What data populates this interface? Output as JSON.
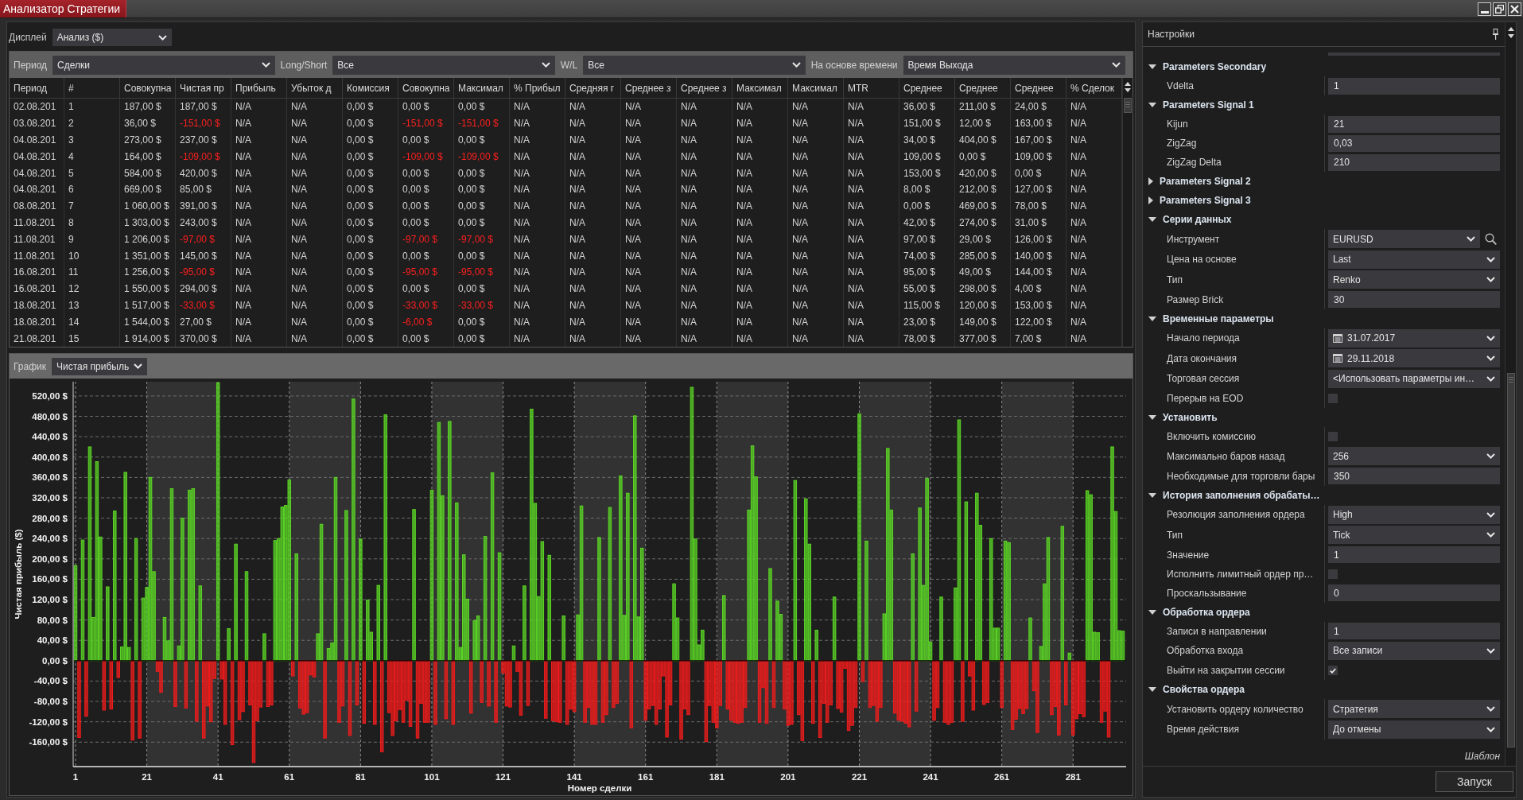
{
  "window": {
    "title": "Анализатор Стратегии"
  },
  "display": {
    "label": "Дисплей",
    "value": "Анализ ($)"
  },
  "filters": [
    {
      "label": "Период",
      "value": "Сделки"
    },
    {
      "label": "Long/Short",
      "value": "Все"
    },
    {
      "label": "W/L",
      "value": "Все"
    },
    {
      "label": "На основе времени",
      "value": "Время Выхода"
    }
  ],
  "table": {
    "columns": [
      "Период",
      "#",
      "Совокупна",
      "Чистая пр",
      "Прибыль",
      "Убыток д",
      "Комиссия",
      "Совокупна",
      "Максимал",
      "% Прибыл",
      "Средняя г",
      "Среднее з",
      "Среднее з",
      "Максимал",
      "Максимал",
      "MTR",
      "Среднее",
      "Среднее",
      "Среднее",
      "% Сделок"
    ],
    "rows": [
      {
        "cells": [
          "02.08.201",
          "1",
          "187,00 $",
          "187,00 $",
          "N/A",
          "N/A",
          "0,00 $",
          "0,00 $",
          "0,00 $",
          "N/A",
          "N/A",
          "N/A",
          "N/A",
          "N/A",
          "N/A",
          "N/A",
          "36,00 $",
          "211,00 $",
          "24,00 $",
          "N/A"
        ],
        "negative": [
          false,
          false,
          false,
          false,
          false,
          false,
          false,
          false,
          false,
          false,
          false,
          false,
          false,
          false,
          false,
          false,
          false,
          false,
          false,
          false
        ]
      },
      {
        "cells": [
          "03.08.201",
          "2",
          "36,00 $",
          "-151,00 $",
          "N/A",
          "N/A",
          "0,00 $",
          "-151,00 $",
          "-151,00 $",
          "N/A",
          "N/A",
          "N/A",
          "N/A",
          "N/A",
          "N/A",
          "N/A",
          "151,00 $",
          "12,00 $",
          "163,00 $",
          "N/A"
        ],
        "negative": [
          false,
          false,
          false,
          true,
          false,
          false,
          false,
          true,
          true,
          false,
          false,
          false,
          false,
          false,
          false,
          false,
          false,
          false,
          false,
          false
        ]
      },
      {
        "cells": [
          "04.08.201",
          "3",
          "273,00 $",
          "237,00 $",
          "N/A",
          "N/A",
          "0,00 $",
          "0,00 $",
          "0,00 $",
          "N/A",
          "N/A",
          "N/A",
          "N/A",
          "N/A",
          "N/A",
          "N/A",
          "34,00 $",
          "404,00 $",
          "167,00 $",
          "N/A"
        ],
        "negative": [
          false,
          false,
          false,
          false,
          false,
          false,
          false,
          false,
          false,
          false,
          false,
          false,
          false,
          false,
          false,
          false,
          false,
          false,
          false,
          false
        ]
      },
      {
        "cells": [
          "04.08.201",
          "4",
          "164,00 $",
          "-109,00 $",
          "N/A",
          "N/A",
          "0,00 $",
          "-109,00 $",
          "-109,00 $",
          "N/A",
          "N/A",
          "N/A",
          "N/A",
          "N/A",
          "N/A",
          "N/A",
          "109,00 $",
          "0,00 $",
          "109,00 $",
          "N/A"
        ],
        "negative": [
          false,
          false,
          false,
          true,
          false,
          false,
          false,
          true,
          true,
          false,
          false,
          false,
          false,
          false,
          false,
          false,
          false,
          false,
          false,
          false
        ]
      },
      {
        "cells": [
          "04.08.201",
          "5",
          "584,00 $",
          "420,00 $",
          "N/A",
          "N/A",
          "0,00 $",
          "0,00 $",
          "0,00 $",
          "N/A",
          "N/A",
          "N/A",
          "N/A",
          "N/A",
          "N/A",
          "N/A",
          "153,00 $",
          "420,00 $",
          "0,00 $",
          "N/A"
        ],
        "negative": [
          false,
          false,
          false,
          false,
          false,
          false,
          false,
          false,
          false,
          false,
          false,
          false,
          false,
          false,
          false,
          false,
          false,
          false,
          false,
          false
        ]
      },
      {
        "cells": [
          "04.08.201",
          "6",
          "669,00 $",
          "85,00 $",
          "N/A",
          "N/A",
          "0,00 $",
          "0,00 $",
          "0,00 $",
          "N/A",
          "N/A",
          "N/A",
          "N/A",
          "N/A",
          "N/A",
          "N/A",
          "8,00 $",
          "212,00 $",
          "127,00 $",
          "N/A"
        ],
        "negative": [
          false,
          false,
          false,
          false,
          false,
          false,
          false,
          false,
          false,
          false,
          false,
          false,
          false,
          false,
          false,
          false,
          false,
          false,
          false,
          false
        ]
      },
      {
        "cells": [
          "08.08.201",
          "7",
          "1 060,00 $",
          "391,00 $",
          "N/A",
          "N/A",
          "0,00 $",
          "0,00 $",
          "0,00 $",
          "N/A",
          "N/A",
          "N/A",
          "N/A",
          "N/A",
          "N/A",
          "N/A",
          "0,00 $",
          "469,00 $",
          "78,00 $",
          "N/A"
        ],
        "negative": [
          false,
          false,
          false,
          false,
          false,
          false,
          false,
          false,
          false,
          false,
          false,
          false,
          false,
          false,
          false,
          false,
          false,
          false,
          false,
          false
        ]
      },
      {
        "cells": [
          "11.08.201",
          "8",
          "1 303,00 $",
          "243,00 $",
          "N/A",
          "N/A",
          "0,00 $",
          "0,00 $",
          "0,00 $",
          "N/A",
          "N/A",
          "N/A",
          "N/A",
          "N/A",
          "N/A",
          "N/A",
          "42,00 $",
          "274,00 $",
          "31,00 $",
          "N/A"
        ],
        "negative": [
          false,
          false,
          false,
          false,
          false,
          false,
          false,
          false,
          false,
          false,
          false,
          false,
          false,
          false,
          false,
          false,
          false,
          false,
          false,
          false
        ]
      },
      {
        "cells": [
          "11.08.201",
          "9",
          "1 206,00 $",
          "-97,00 $",
          "N/A",
          "N/A",
          "0,00 $",
          "-97,00 $",
          "-97,00 $",
          "N/A",
          "N/A",
          "N/A",
          "N/A",
          "N/A",
          "N/A",
          "N/A",
          "97,00 $",
          "29,00 $",
          "126,00 $",
          "N/A"
        ],
        "negative": [
          false,
          false,
          false,
          true,
          false,
          false,
          false,
          true,
          true,
          false,
          false,
          false,
          false,
          false,
          false,
          false,
          false,
          false,
          false,
          false
        ]
      },
      {
        "cells": [
          "11.08.201",
          "10",
          "1 351,00 $",
          "145,00 $",
          "N/A",
          "N/A",
          "0,00 $",
          "0,00 $",
          "0,00 $",
          "N/A",
          "N/A",
          "N/A",
          "N/A",
          "N/A",
          "N/A",
          "N/A",
          "74,00 $",
          "285,00 $",
          "140,00 $",
          "N/A"
        ],
        "negative": [
          false,
          false,
          false,
          false,
          false,
          false,
          false,
          false,
          false,
          false,
          false,
          false,
          false,
          false,
          false,
          false,
          false,
          false,
          false,
          false
        ]
      },
      {
        "cells": [
          "16.08.201",
          "11",
          "1 256,00 $",
          "-95,00 $",
          "N/A",
          "N/A",
          "0,00 $",
          "-95,00 $",
          "-95,00 $",
          "N/A",
          "N/A",
          "N/A",
          "N/A",
          "N/A",
          "N/A",
          "N/A",
          "95,00 $",
          "49,00 $",
          "144,00 $",
          "N/A"
        ],
        "negative": [
          false,
          false,
          false,
          true,
          false,
          false,
          false,
          true,
          true,
          false,
          false,
          false,
          false,
          false,
          false,
          false,
          false,
          false,
          false,
          false
        ]
      },
      {
        "cells": [
          "16.08.201",
          "12",
          "1 550,00 $",
          "294,00 $",
          "N/A",
          "N/A",
          "0,00 $",
          "0,00 $",
          "0,00 $",
          "N/A",
          "N/A",
          "N/A",
          "N/A",
          "N/A",
          "N/A",
          "N/A",
          "55,00 $",
          "298,00 $",
          "4,00 $",
          "N/A"
        ],
        "negative": [
          false,
          false,
          false,
          false,
          false,
          false,
          false,
          false,
          false,
          false,
          false,
          false,
          false,
          false,
          false,
          false,
          false,
          false,
          false,
          false
        ]
      },
      {
        "cells": [
          "18.08.201",
          "13",
          "1 517,00 $",
          "-33,00 $",
          "N/A",
          "N/A",
          "0,00 $",
          "-33,00 $",
          "-33,00 $",
          "N/A",
          "N/A",
          "N/A",
          "N/A",
          "N/A",
          "N/A",
          "N/A",
          "115,00 $",
          "120,00 $",
          "153,00 $",
          "N/A"
        ],
        "negative": [
          false,
          false,
          false,
          true,
          false,
          false,
          false,
          true,
          true,
          false,
          false,
          false,
          false,
          false,
          false,
          false,
          false,
          false,
          false,
          false
        ]
      },
      {
        "cells": [
          "18.08.201",
          "14",
          "1 544,00 $",
          "27,00 $",
          "N/A",
          "N/A",
          "0,00 $",
          "-6,00 $",
          "0,00 $",
          "N/A",
          "N/A",
          "N/A",
          "N/A",
          "N/A",
          "N/A",
          "N/A",
          "23,00 $",
          "149,00 $",
          "122,00 $",
          "N/A"
        ],
        "negative": [
          false,
          false,
          false,
          false,
          false,
          false,
          false,
          true,
          false,
          false,
          false,
          false,
          false,
          false,
          false,
          false,
          false,
          false,
          false,
          false
        ]
      },
      {
        "cells": [
          "21.08.201",
          "15",
          "1 914,00 $",
          "370,00 $",
          "N/A",
          "N/A",
          "0,00 $",
          "0,00 $",
          "0,00 $",
          "N/A",
          "N/A",
          "N/A",
          "N/A",
          "N/A",
          "N/A",
          "N/A",
          "78,00 $",
          "377,00 $",
          "7,00 $",
          "N/A"
        ],
        "negative": [
          false,
          false,
          false,
          false,
          false,
          false,
          false,
          false,
          false,
          false,
          false,
          false,
          false,
          false,
          false,
          false,
          false,
          false,
          false,
          false
        ]
      }
    ]
  },
  "graph": {
    "label": "График",
    "value": "Чистая прибыль",
    "chart_data": [
      {
        "type": "bar",
        "xlabel": "Номер сделки",
        "ylabel": "Чистая прибыль ($)",
        "grid": true,
        "xlim": [
          0.33,
          295.9
        ],
        "ylim": [
          -208,
          548
        ],
        "xticks": [
          1,
          21,
          41,
          61,
          81,
          101,
          121,
          141,
          161,
          181,
          201,
          221,
          241,
          261,
          281
        ],
        "yticks": [
          {
            "value": -160,
            "label": "-160,00 $"
          },
          {
            "value": -120,
            "label": "-120,00 $"
          },
          {
            "value": -80,
            "label": "-80,00 $"
          },
          {
            "value": -40,
            "label": "-40,00 $"
          },
          {
            "value": 0,
            "label": "0,00 $"
          },
          {
            "value": 40,
            "label": "40,00 $"
          },
          {
            "value": 80,
            "label": "80,00 $"
          },
          {
            "value": 120,
            "label": "120,00 $"
          },
          {
            "value": 160,
            "label": "160,00 $"
          },
          {
            "value": 200,
            "label": "200,00 $"
          },
          {
            "value": 240,
            "label": "240,00 $"
          },
          {
            "value": 280,
            "label": "280,00 $"
          },
          {
            "value": 320,
            "label": "320,00 $"
          },
          {
            "value": 360,
            "label": "360,00 $"
          },
          {
            "value": 400,
            "label": "400,00 $"
          },
          {
            "value": 440,
            "label": "440,00 $"
          },
          {
            "value": 480,
            "label": "480,00 $"
          },
          {
            "value": 520,
            "label": "520,00 $"
          }
        ],
        "x": [
          1,
          2,
          3,
          4,
          5,
          6,
          7,
          8,
          9,
          10,
          11,
          12,
          13,
          14,
          15,
          16,
          17,
          18,
          19,
          20,
          21,
          22,
          23,
          24,
          25,
          26,
          27,
          28,
          29,
          30,
          31,
          32,
          33,
          34,
          35,
          36,
          37,
          38,
          39,
          40,
          41,
          42,
          43,
          44,
          45,
          46,
          47,
          48,
          49,
          50,
          51,
          52,
          53,
          54,
          55,
          56,
          57,
          58,
          59,
          60,
          61,
          62,
          63,
          64,
          65,
          66,
          67,
          68,
          69,
          70,
          71,
          72,
          73,
          74,
          75,
          76,
          77,
          78,
          79,
          80,
          81,
          82,
          83,
          84,
          85,
          86,
          87,
          88,
          89,
          90,
          91,
          92,
          93,
          94,
          95,
          96,
          97,
          98,
          99,
          100,
          101,
          102,
          103,
          104,
          105,
          106,
          107,
          108,
          109,
          110,
          111,
          112,
          113,
          114,
          115,
          116,
          117,
          118,
          119,
          120,
          121,
          122,
          123,
          124,
          125,
          126,
          127,
          128,
          129,
          130,
          131,
          132,
          133,
          134,
          135,
          136,
          137,
          138,
          139,
          140,
          141,
          142,
          143,
          144,
          145,
          146,
          147,
          148,
          149,
          150,
          151,
          152,
          153,
          154,
          155,
          156,
          157,
          158,
          159,
          160,
          161,
          162,
          163,
          164,
          165,
          166,
          167,
          168,
          169,
          170,
          171,
          172,
          173,
          174,
          175,
          176,
          177,
          178,
          179,
          180,
          181,
          182,
          183,
          184,
          185,
          186,
          187,
          188,
          189,
          190,
          191,
          192,
          193,
          194,
          195,
          196,
          197,
          198,
          199,
          200,
          201,
          202,
          203,
          204,
          205,
          206,
          207,
          208,
          209,
          210,
          211,
          212,
          213,
          214,
          215,
          216,
          217,
          218,
          219,
          220,
          221,
          222,
          223,
          224,
          225,
          226,
          227,
          228,
          229,
          230,
          231,
          232,
          233,
          234,
          235,
          236,
          237,
          238,
          239,
          240,
          241,
          242,
          243,
          244,
          245,
          246,
          247,
          248,
          249,
          250,
          251,
          252,
          253,
          254,
          255,
          256,
          257,
          258,
          259,
          260,
          261,
          262,
          263,
          264,
          265,
          266,
          267,
          268,
          269,
          270,
          271,
          272,
          273,
          274,
          275,
          276,
          277,
          278,
          279,
          280,
          281,
          282,
          283,
          284,
          285,
          286,
          287,
          288,
          289,
          290,
          291,
          292,
          293,
          294,
          295
        ],
        "values": [
          187,
          -151,
          237,
          -109,
          420,
          85,
          391,
          243,
          -97,
          145,
          -95,
          294,
          -33,
          27,
          370,
          26,
          -156,
          240,
          -152,
          123,
          144,
          360,
          175,
          -21,
          -62,
          85,
          39,
          338,
          -90,
          29,
          280,
          -93,
          335,
          338,
          -119,
          147,
          -152,
          -89,
          -120,
          -35,
          546,
          -36,
          -125,
          63,
          -165,
          229,
          -116,
          -100,
          175,
          -87,
          -200,
          -118,
          -91,
          53,
          -90,
          -87,
          236,
          240,
          302,
          305,
          355,
          -30,
          210,
          -93,
          -105,
          -102,
          -28,
          -32,
          53,
          268,
          -152,
          24,
          35,
          360,
          -121,
          -89,
          295,
          -147,
          514,
          -87,
          239,
          -123,
          119,
          56,
          -125,
          148,
          -179,
          483,
          -102,
          -147,
          -118,
          -96,
          -121,
          -78,
          -129,
          297,
          -152,
          -84,
          -121,
          -121,
          335,
          -125,
          468,
          324,
          -114,
          470,
          -125,
          310,
          26,
          208,
          121,
          -103,
          79,
          88,
          -82,
          244,
          -89,
          369,
          -121,
          212,
          -24,
          -89,
          -91,
          29,
          -21,
          -107,
          147,
          -88,
          494,
          309,
          126,
          234,
          -113,
          207,
          -118,
          -120,
          -121,
          88,
          -125,
          -95,
          -100,
          90,
          304,
          -121,
          -92,
          -125,
          -125,
          242,
          -121,
          -106,
          301,
          -92,
          -84,
          363,
          89,
          329,
          -132,
          481,
          86,
          221,
          -117,
          -95,
          -88,
          -125,
          -95,
          -30,
          -150,
          -87,
          151,
          84,
          -154,
          -95,
          -106,
          537,
          239,
          31,
          60,
          -159,
          -88,
          -121,
          -132,
          -88,
          128,
          -95,
          -117,
          -121,
          -123,
          -121,
          -92,
          296,
          422,
          361,
          -121,
          -53,
          -123,
          181,
          -92,
          117,
          91,
          -95,
          -127,
          -125,
          354,
          -106,
          -157,
          318,
          229,
          -123,
          60,
          -151,
          -84,
          -121,
          -87,
          125,
          -94,
          -101,
          -15,
          -137,
          -127,
          -92,
          485,
          -41,
          235,
          -92,
          -88,
          -119,
          -92,
          92,
          417,
          296,
          -103,
          -117,
          -119,
          -123,
          -130,
          210,
          -99,
          300,
          148,
          358,
          37,
          -117,
          -92,
          125,
          -121,
          -125,
          -121,
          143,
          473,
          -119,
          312,
          -30,
          -97,
          329,
          266,
          -86,
          -82,
          240,
          64,
          64,
          -92,
          235,
          232,
          -135,
          -115,
          -94,
          -104,
          -94,
          84,
          -59,
          -141,
          28,
          151,
          242,
          -106,
          -90,
          -146,
          264,
          -87,
          15,
          -146,
          -114,
          -104,
          -110,
          334,
          326,
          56,
          55,
          -121,
          -99,
          -150,
          420,
          293,
          59,
          58
        ],
        "colors": [
          "#5bd625",
          "#f01c1c",
          "#5bd625",
          "#f01c1c",
          "#5bd625",
          "#5bd625",
          "#5bd625",
          "#5bd625",
          "#f01c1c",
          "#5bd625",
          "#f01c1c",
          "#5bd625",
          "#f01c1c",
          "#5bd625",
          "#5bd625",
          "#5bd625",
          "#f01c1c",
          "#5bd625",
          "#f01c1c",
          "#5bd625",
          "#5bd625",
          "#5bd625",
          "#5bd625",
          "#f01c1c",
          "#f01c1c",
          "#5bd625",
          "#5bd625",
          "#5bd625",
          "#f01c1c",
          "#5bd625",
          "#5bd625",
          "#f01c1c",
          "#5bd625",
          "#5bd625",
          "#f01c1c",
          "#5bd625",
          "#f01c1c",
          "#f01c1c",
          "#f01c1c",
          "#f01c1c",
          "#5bd625",
          "#f01c1c",
          "#f01c1c",
          "#5bd625",
          "#f01c1c",
          "#5bd625",
          "#f01c1c",
          "#f01c1c",
          "#5bd625",
          "#f01c1c",
          "#f01c1c",
          "#f01c1c",
          "#f01c1c",
          "#5bd625",
          "#f01c1c",
          "#f01c1c",
          "#5bd625",
          "#5bd625",
          "#5bd625",
          "#5bd625",
          "#5bd625",
          "#f01c1c",
          "#5bd625",
          "#f01c1c",
          "#f01c1c",
          "#f01c1c",
          "#f01c1c",
          "#f01c1c",
          "#5bd625",
          "#5bd625",
          "#f01c1c",
          "#5bd625",
          "#5bd625",
          "#5bd625",
          "#f01c1c",
          "#f01c1c",
          "#5bd625",
          "#f01c1c",
          "#5bd625",
          "#f01c1c",
          "#5bd625",
          "#f01c1c",
          "#5bd625",
          "#5bd625",
          "#f01c1c",
          "#5bd625",
          "#f01c1c",
          "#5bd625",
          "#f01c1c",
          "#f01c1c",
          "#f01c1c",
          "#f01c1c",
          "#f01c1c",
          "#f01c1c",
          "#f01c1c",
          "#5bd625",
          "#f01c1c",
          "#f01c1c",
          "#f01c1c",
          "#f01c1c",
          "#5bd625",
          "#f01c1c",
          "#5bd625",
          "#5bd625",
          "#f01c1c",
          "#5bd625",
          "#f01c1c",
          "#5bd625",
          "#5bd625",
          "#5bd625",
          "#5bd625",
          "#f01c1c",
          "#5bd625",
          "#5bd625",
          "#f01c1c",
          "#5bd625",
          "#f01c1c",
          "#5bd625",
          "#f01c1c",
          "#5bd625",
          "#f01c1c",
          "#f01c1c",
          "#f01c1c",
          "#5bd625",
          "#f01c1c",
          "#f01c1c",
          "#5bd625",
          "#f01c1c",
          "#5bd625",
          "#5bd625",
          "#5bd625",
          "#5bd625",
          "#f01c1c",
          "#5bd625",
          "#f01c1c",
          "#f01c1c",
          "#f01c1c",
          "#5bd625",
          "#f01c1c",
          "#f01c1c",
          "#f01c1c",
          "#5bd625",
          "#5bd625",
          "#f01c1c",
          "#f01c1c",
          "#f01c1c",
          "#f01c1c",
          "#5bd625",
          "#f01c1c",
          "#f01c1c",
          "#5bd625",
          "#f01c1c",
          "#f01c1c",
          "#5bd625",
          "#5bd625",
          "#5bd625",
          "#f01c1c",
          "#5bd625",
          "#5bd625",
          "#5bd625",
          "#f01c1c",
          "#f01c1c",
          "#f01c1c",
          "#f01c1c",
          "#f01c1c",
          "#f01c1c",
          "#f01c1c",
          "#f01c1c",
          "#5bd625",
          "#5bd625",
          "#f01c1c",
          "#f01c1c",
          "#f01c1c",
          "#5bd625",
          "#5bd625",
          "#5bd625",
          "#5bd625",
          "#f01c1c",
          "#f01c1c",
          "#f01c1c",
          "#f01c1c",
          "#f01c1c",
          "#5bd625",
          "#f01c1c",
          "#f01c1c",
          "#f01c1c",
          "#f01c1c",
          "#f01c1c",
          "#f01c1c",
          "#5bd625",
          "#5bd625",
          "#5bd625",
          "#f01c1c",
          "#f01c1c",
          "#f01c1c",
          "#5bd625",
          "#f01c1c",
          "#5bd625",
          "#5bd625",
          "#f01c1c",
          "#f01c1c",
          "#f01c1c",
          "#5bd625",
          "#f01c1c",
          "#f01c1c",
          "#5bd625",
          "#5bd625",
          "#f01c1c",
          "#5bd625",
          "#f01c1c",
          "#f01c1c",
          "#f01c1c",
          "#f01c1c",
          "#5bd625",
          "#f01c1c",
          "#f01c1c",
          "#f01c1c",
          "#f01c1c",
          "#f01c1c",
          "#f01c1c",
          "#5bd625",
          "#f01c1c",
          "#5bd625",
          "#f01c1c",
          "#f01c1c",
          "#f01c1c",
          "#f01c1c",
          "#5bd625",
          "#5bd625",
          "#5bd625",
          "#f01c1c",
          "#f01c1c",
          "#f01c1c",
          "#f01c1c",
          "#f01c1c",
          "#5bd625",
          "#f01c1c",
          "#5bd625",
          "#5bd625",
          "#5bd625",
          "#5bd625",
          "#f01c1c",
          "#f01c1c",
          "#5bd625",
          "#f01c1c",
          "#f01c1c",
          "#f01c1c",
          "#5bd625",
          "#5bd625",
          "#f01c1c",
          "#5bd625",
          "#f01c1c",
          "#f01c1c",
          "#5bd625",
          "#5bd625",
          "#f01c1c",
          "#f01c1c",
          "#5bd625",
          "#5bd625",
          "#5bd625",
          "#f01c1c",
          "#5bd625",
          "#5bd625",
          "#f01c1c",
          "#f01c1c",
          "#f01c1c",
          "#f01c1c",
          "#f01c1c",
          "#5bd625",
          "#f01c1c",
          "#f01c1c",
          "#5bd625",
          "#5bd625",
          "#5bd625",
          "#f01c1c",
          "#f01c1c",
          "#f01c1c",
          "#5bd625",
          "#f01c1c",
          "#5bd625",
          "#f01c1c",
          "#f01c1c",
          "#f01c1c",
          "#f01c1c",
          "#5bd625",
          "#5bd625",
          "#5bd625",
          "#5bd625",
          "#f01c1c",
          "#f01c1c",
          "#f01c1c",
          "#5bd625",
          "#5bd625",
          "#5bd625",
          "#5bd625"
        ]
      }
    ]
  },
  "settings": {
    "title": "Настройки",
    "groups": [
      {
        "title": "Parameters Secondary",
        "expanded": true,
        "items": [
          {
            "kind": "text",
            "label": "Vdelta",
            "value": "1"
          }
        ]
      },
      {
        "title": "Parameters Signal 1",
        "expanded": true,
        "items": [
          {
            "kind": "text",
            "label": "Kijun",
            "value": "21"
          },
          {
            "kind": "text",
            "label": "ZigZag",
            "value": "0,03"
          },
          {
            "kind": "text",
            "label": "ZigZag Delta",
            "value": "210"
          }
        ]
      },
      {
        "title": "Parameters Signal 2",
        "expanded": false
      },
      {
        "title": "Parameters Signal 3",
        "expanded": false
      },
      {
        "title": "Серии данных",
        "expanded": true,
        "items": [
          {
            "kind": "lookup",
            "label": "Инструмент",
            "value": "EURUSD"
          },
          {
            "kind": "dropdown",
            "label": "Цена на основе",
            "value": "Last"
          },
          {
            "kind": "dropdown",
            "label": "Тип",
            "value": "Renko"
          },
          {
            "kind": "text",
            "label": "Размер Brick",
            "value": "30"
          }
        ]
      },
      {
        "title": "Временные параметры",
        "expanded": true,
        "items": [
          {
            "kind": "date",
            "label": "Начало периода",
            "value": "31.07.2017"
          },
          {
            "kind": "date",
            "label": "Дата окончания",
            "value": "29.11.2018"
          },
          {
            "kind": "dropdown",
            "label": "Торговая сессия",
            "value": "<Использовать параметры ин…"
          },
          {
            "kind": "checkbox",
            "label": "Перерыв на EOD",
            "checked": false
          }
        ]
      },
      {
        "title": "Установить",
        "expanded": true,
        "items": [
          {
            "kind": "checkbox",
            "label": "Включить комиссию",
            "checked": false
          },
          {
            "kind": "dropdown",
            "label": "Максимально баров назад",
            "value": "256"
          },
          {
            "kind": "text",
            "label": "Необходимые для торговли бары",
            "value": "350"
          }
        ]
      },
      {
        "title": "История заполнения обрабаты…",
        "expanded": true,
        "items": [
          {
            "kind": "dropdown",
            "label": "Резолюция заполнения ордера",
            "value": "High"
          },
          {
            "kind": "dropdown",
            "label": "Тип",
            "value": "Tick"
          },
          {
            "kind": "text",
            "label": "Значение",
            "value": "1"
          },
          {
            "kind": "checkbox",
            "label": "Исполнить лимитный ордер пр…",
            "checked": false
          },
          {
            "kind": "text",
            "label": "Проскальзывание",
            "value": "0"
          }
        ]
      },
      {
        "title": "Обработка ордера",
        "expanded": true,
        "items": [
          {
            "kind": "text",
            "label": "Записи в направлении",
            "value": "1"
          },
          {
            "kind": "dropdown",
            "label": "Обработка входа",
            "value": "Все записи"
          },
          {
            "kind": "checkbox",
            "label": "Выйти на закрытии сессии",
            "checked": true
          }
        ]
      },
      {
        "title": "Свойства ордера",
        "expanded": true,
        "items": [
          {
            "kind": "dropdown",
            "label": "Установить ордеру количество",
            "value": "Стратегия"
          },
          {
            "kind": "dropdown",
            "label": "Время действия",
            "value": "До отмены"
          }
        ]
      }
    ],
    "template_link": "Шаблон",
    "run_button": "Запуск"
  }
}
